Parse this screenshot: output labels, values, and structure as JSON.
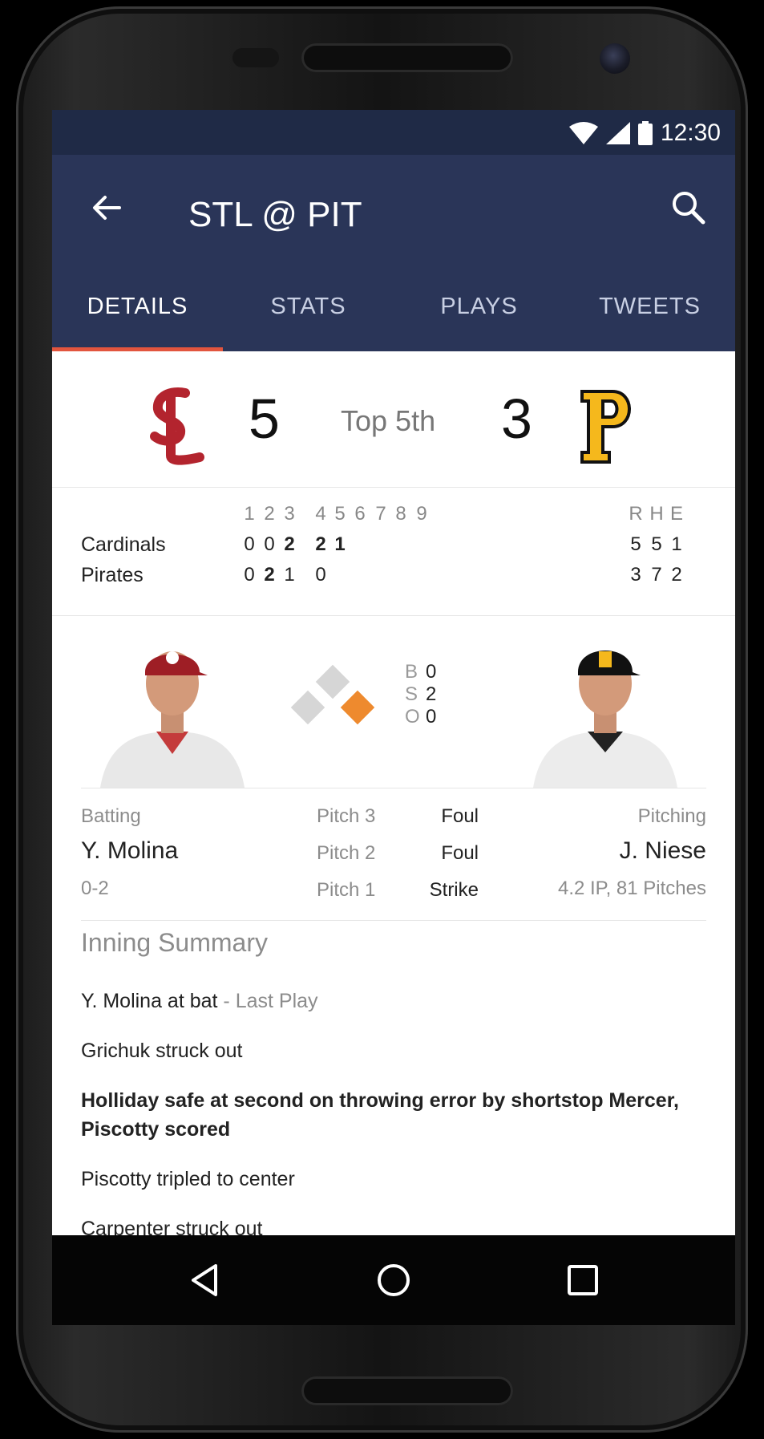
{
  "status": {
    "time": "12:30",
    "icons": [
      "wifi-icon",
      "cell-signal-icon",
      "battery-icon"
    ]
  },
  "appbar": {
    "title": "STL @ PIT",
    "back_icon": "arrow-left-icon",
    "search_icon": "search-icon"
  },
  "tabs": [
    {
      "label": "DETAILS",
      "active": true
    },
    {
      "label": "STATS",
      "active": false
    },
    {
      "label": "PLAYS",
      "active": false
    },
    {
      "label": "TWEETS",
      "active": false
    }
  ],
  "score": {
    "away_runs": "5",
    "inning": "Top 5th",
    "home_runs": "3",
    "away_logo": "cardinals-logo",
    "home_logo": "pirates-logo"
  },
  "linescore": {
    "innings": [
      "1",
      "2",
      "3",
      "4",
      "5",
      "6",
      "7",
      "8",
      "9"
    ],
    "totals_headers": [
      "R",
      "H",
      "E"
    ],
    "teams": [
      {
        "name": "Cardinals",
        "innings": [
          "0",
          "0",
          "2",
          "2",
          "1",
          "",
          "",
          "",
          ""
        ],
        "totals": [
          "5",
          "5",
          "1"
        ]
      },
      {
        "name": "Pirates",
        "innings": [
          "0",
          "2",
          "1",
          "0",
          "",
          "",
          "",
          "",
          ""
        ],
        "totals": [
          "3",
          "7",
          "2"
        ]
      }
    ]
  },
  "count": [
    {
      "label": "B",
      "value": "0"
    },
    {
      "label": "S",
      "value": "2"
    },
    {
      "label": "O",
      "value": "0"
    }
  ],
  "batting": {
    "label": "Batting",
    "name": "Y. Molina",
    "line": "0-2"
  },
  "pitching": {
    "label": "Pitching",
    "name": "J. Niese",
    "line": "4.2 IP, 81 Pitches"
  },
  "pitches": [
    {
      "label": "Pitch 3",
      "result": "Foul"
    },
    {
      "label": "Pitch 2",
      "result": "Foul"
    },
    {
      "label": "Pitch 1",
      "result": "Strike"
    }
  ],
  "summary": {
    "title": "Inning Summary",
    "last_play_batter": "Y. Molina at bat",
    "last_play_tag": " - Last Play",
    "plays": [
      "Grichuk struck out",
      "Holliday safe at second on throwing error by shortstop Mercer, Piscotty scored",
      "Piscotty tripled to center",
      "Carpenter struck out"
    ]
  },
  "navbar": {
    "icons": [
      "back-triangle-icon",
      "home-circle-icon",
      "recents-square-icon"
    ]
  },
  "colors": {
    "appbar": "#2a3558",
    "statusbar": "#1f2a46",
    "tab_indicator": "#e2553e",
    "runner_on_base": "#ee8a2e"
  }
}
